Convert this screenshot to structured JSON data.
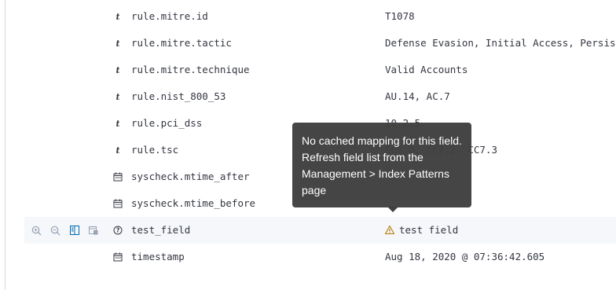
{
  "fields": [
    {
      "type": "t",
      "name": "rule.mitre.id",
      "value": "T1078"
    },
    {
      "type": "t",
      "name": "rule.mitre.tactic",
      "value": "Defense Evasion, Initial Access, Persistence"
    },
    {
      "type": "t",
      "name": "rule.mitre.technique",
      "value": "Valid Accounts"
    },
    {
      "type": "t",
      "name": "rule.nist_800_53",
      "value": "AU.14, AC.7"
    },
    {
      "type": "t",
      "name": "rule.pci_dss",
      "value": "10.2.5"
    },
    {
      "type": "t",
      "name": "rule.tsc",
      "value": "CC6.8, CC7.2, CC7.3"
    },
    {
      "type": "date",
      "name": "syscheck.mtime_after",
      "value": ""
    },
    {
      "type": "date",
      "name": "syscheck.mtime_before",
      "value": ""
    },
    {
      "type": "unknown",
      "name": "test_field",
      "value": "test field",
      "warning": true,
      "highlighted": true
    },
    {
      "type": "date",
      "name": "timestamp",
      "value": "Aug 18, 2020 @ 07:36:42.605"
    }
  ],
  "tooltip": {
    "text": "No cached mapping for this field. Refresh field list from the Management > Index Patterns page"
  },
  "colors": {
    "accent": "#006bb4",
    "warning": "#b47b00",
    "tooltip_bg": "#404040",
    "text": "#343741"
  }
}
